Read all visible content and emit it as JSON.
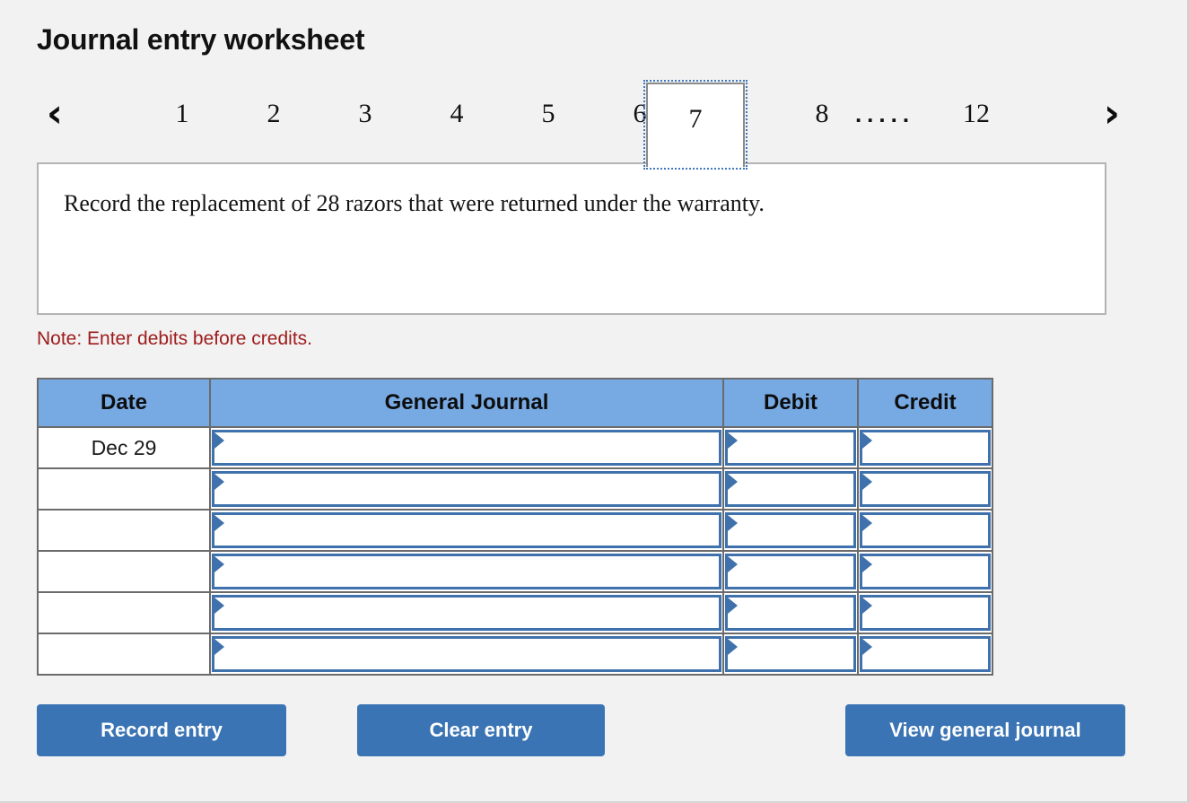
{
  "page": {
    "title": "Journal entry worksheet"
  },
  "tabs": {
    "prev_icon": "chevron-left-icon",
    "next_icon": "chevron-right-icon",
    "prev_glyph": "‹",
    "next_glyph": "›",
    "items": [
      {
        "label": "1",
        "selected": false
      },
      {
        "label": "2",
        "selected": false
      },
      {
        "label": "3",
        "selected": false
      },
      {
        "label": "4",
        "selected": false
      },
      {
        "label": "5",
        "selected": false
      },
      {
        "label": "6",
        "selected": false
      },
      {
        "label": "7",
        "selected": true
      },
      {
        "label": "8",
        "selected": false
      },
      {
        "label": ".....",
        "selected": false
      },
      {
        "label": "12",
        "selected": false
      }
    ],
    "selected_label": "7"
  },
  "description": {
    "text": "Record the replacement of 28 razors that were returned under the warranty."
  },
  "note": {
    "text": "Note: Enter debits before credits."
  },
  "table": {
    "columns": [
      "Date",
      "General Journal",
      "Debit",
      "Credit"
    ],
    "rows": [
      {
        "date": "Dec 29",
        "general_journal": "",
        "debit": "",
        "credit": ""
      },
      {
        "date": "",
        "general_journal": "",
        "debit": "",
        "credit": ""
      },
      {
        "date": "",
        "general_journal": "",
        "debit": "",
        "credit": ""
      },
      {
        "date": "",
        "general_journal": "",
        "debit": "",
        "credit": ""
      },
      {
        "date": "",
        "general_journal": "",
        "debit": "",
        "credit": ""
      },
      {
        "date": "",
        "general_journal": "",
        "debit": "",
        "credit": ""
      }
    ]
  },
  "buttons": {
    "record": "Record entry",
    "clear": "Clear entry",
    "view": "View general journal"
  },
  "colors": {
    "page_background": "#f2f2f2",
    "table_header_blue": "#77a9e3",
    "input_border_blue": "#3f72ad",
    "button_blue": "#3b74b4",
    "note_red": "#9e1b1b",
    "selected_tab_outline": "#3f77bd"
  }
}
